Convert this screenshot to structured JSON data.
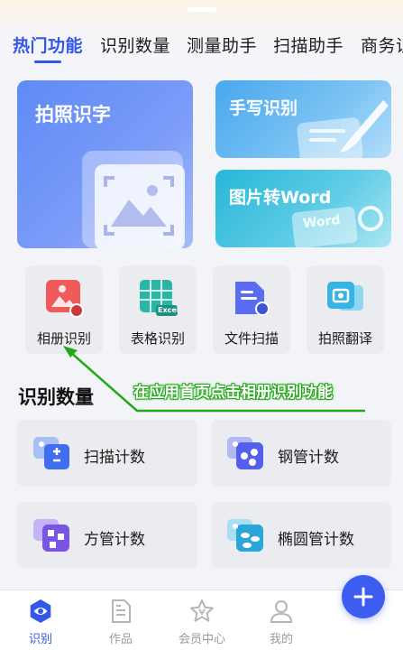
{
  "tabs": [
    {
      "label": "热门功能",
      "active": true
    },
    {
      "label": "识别数量",
      "active": false
    },
    {
      "label": "测量助手",
      "active": false
    },
    {
      "label": "扫描助手",
      "active": false
    },
    {
      "label": "商务识",
      "active": false
    }
  ],
  "feature_cards": {
    "photo_text": {
      "label": "拍照识字",
      "icon": "photo-frame-icon"
    },
    "handwriting": {
      "label": "手写识别",
      "icon": "brush-icon"
    },
    "image_to_word": {
      "label": "图片转Word",
      "icon": "word-convert-icon",
      "badge": "Word"
    }
  },
  "quick_actions": [
    {
      "label": "相册识别",
      "icon": "album-icon",
      "color": "#ef5a5a"
    },
    {
      "label": "表格识别",
      "icon": "excel-icon",
      "color": "#2bb5a5",
      "badge": "Excel"
    },
    {
      "label": "文件扫描",
      "icon": "file-scan-icon",
      "color": "#5a6df2"
    },
    {
      "label": "拍照翻译",
      "icon": "camera-translate-icon",
      "color": "#37b4e3"
    }
  ],
  "section": {
    "title": "识别数量"
  },
  "annotation": {
    "text": "在应用首页点击相册识别功能",
    "color": "#24a81a"
  },
  "count_items": [
    {
      "label": "扫描计数",
      "icon": "scan-count-icon"
    },
    {
      "label": "钢管计数",
      "icon": "steel-pipe-icon"
    },
    {
      "label": "方管计数",
      "icon": "square-pipe-icon"
    },
    {
      "label": "椭圆管计数",
      "icon": "oval-pipe-icon"
    }
  ],
  "bottom_nav": [
    {
      "label": "识别",
      "icon": "eye-icon",
      "active": true
    },
    {
      "label": "作品",
      "icon": "document-icon",
      "active": false
    },
    {
      "label": "会员中心",
      "icon": "star-v-icon",
      "active": false
    },
    {
      "label": "我的",
      "icon": "user-icon",
      "active": false
    }
  ],
  "fab": {
    "icon": "plus-icon"
  },
  "colors": {
    "accent": "#3357e8",
    "fab": "#3d5cf0",
    "background": "#f3f4f8"
  }
}
